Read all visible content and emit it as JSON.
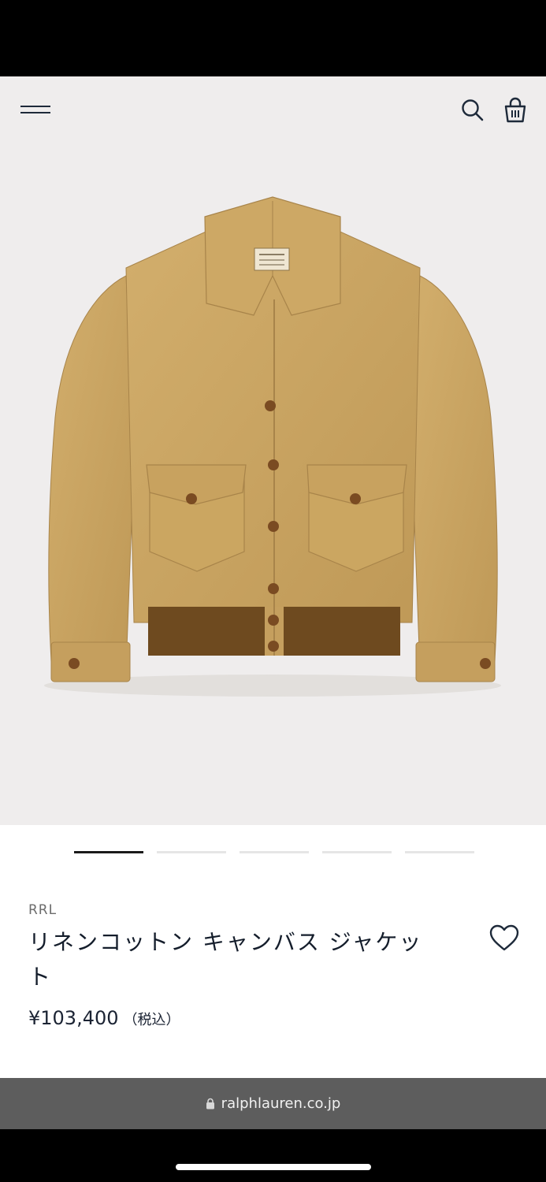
{
  "header": {
    "menu_icon": "hamburger-menu-icon",
    "search_icon": "search-icon",
    "bag_icon": "shopping-bag-icon"
  },
  "gallery": {
    "image_count": 5,
    "active_index": 0
  },
  "product": {
    "brand": "RRL",
    "title": "リネンコットン キャンバス ジャケット",
    "price": "¥103,400",
    "tax_note": "（税込）",
    "wishlist_icon": "heart-outline-icon"
  },
  "browser": {
    "url": "ralphlauren.co.jp",
    "lock_icon": "lock-icon"
  },
  "colors": {
    "hero_bg": "#efeded",
    "text_dark": "#141d2b",
    "url_bar_bg": "#5d5d5d",
    "jacket_tan": "#c9a462",
    "rib_brown": "#6e4a1f"
  }
}
